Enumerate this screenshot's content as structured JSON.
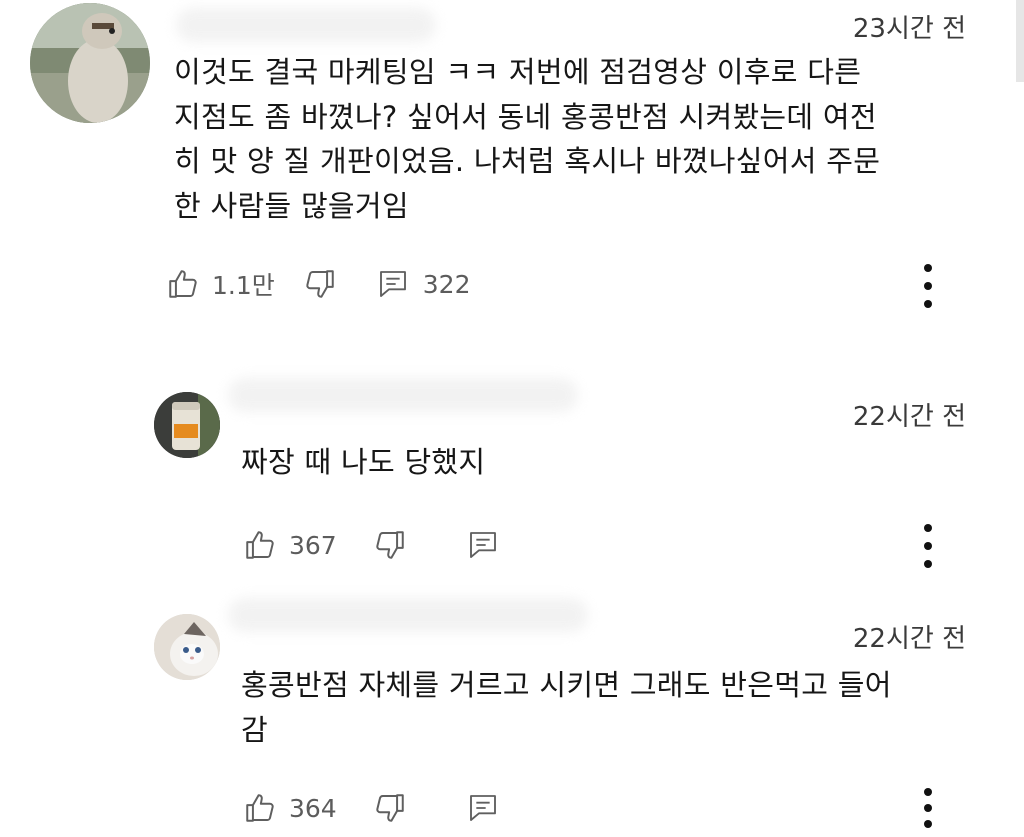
{
  "comments": [
    {
      "time": "23시간 전",
      "text": "이것도 결국 마케팅임 ㅋㅋ 저번에 점검영상 이후로 다른\n지점도 좀 바꼈나? 싶어서 동네 홍콩반점 시켜봤는데 여전\n히 맛 양 질 개판이었음. 나처럼 혹시나 바꼈나싶어서 주문\n한 사람들 많을거임",
      "likes": "1.1만",
      "replies": "322",
      "avatar_icon": "bird-photo-icon"
    },
    {
      "time": "22시간 전",
      "text": "짜장 때 나도 당했지",
      "likes": "367",
      "avatar_icon": "drink-can-photo-icon"
    },
    {
      "time": "22시간 전",
      "text": "홍콩반점 자체를 거르고 시키면 그래도 반은먹고 들어\n감",
      "likes": "364",
      "avatar_icon": "cat-photo-icon"
    }
  ],
  "icons": {
    "like": "thumbs-up-icon",
    "dislike": "thumbs-down-icon",
    "reply": "reply-comment-icon",
    "more": "more-vertical-icon"
  }
}
